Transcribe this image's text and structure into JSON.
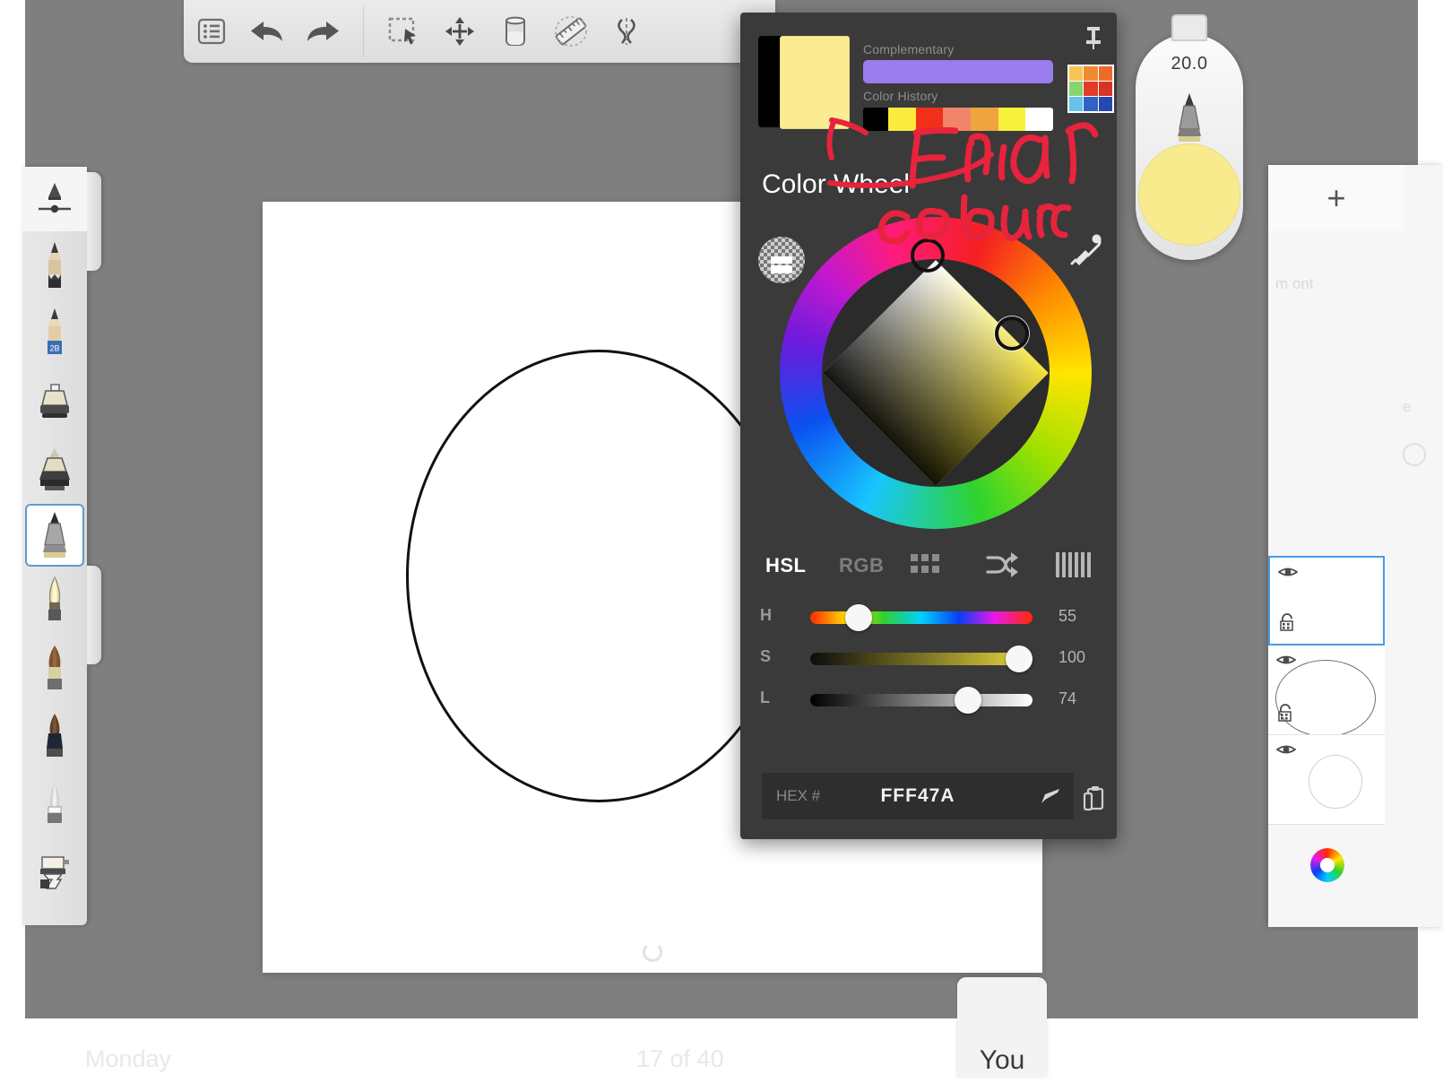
{
  "app": {
    "canvas_bg": "#807f7f",
    "paper_color": "#ffffff"
  },
  "toolbar": {
    "items": [
      {
        "name": "layers-menu-icon",
        "label": "Menu"
      },
      {
        "name": "undo-icon",
        "label": "Undo"
      },
      {
        "name": "redo-icon",
        "label": "Redo"
      },
      {
        "name": "selection-icon",
        "label": "Select"
      },
      {
        "name": "transform-move-icon",
        "label": "Transform"
      },
      {
        "name": "water-jar-icon",
        "label": "Water"
      },
      {
        "name": "ruler-icon",
        "label": "Ruler"
      },
      {
        "name": "symmetry-icon",
        "label": "Symmetry"
      }
    ]
  },
  "brush_rail": {
    "items": [
      {
        "name": "brush-size-slider-header",
        "label": "Brush Settings"
      },
      {
        "name": "brush-pencil",
        "label": "Pencil"
      },
      {
        "name": "brush-pencil-2b",
        "label": "2B Pencil",
        "badge": "2B"
      },
      {
        "name": "brush-eraser-block",
        "label": "Eraser"
      },
      {
        "name": "brush-marker",
        "label": "Marker"
      },
      {
        "name": "brush-inkpen",
        "label": "Ink Pen",
        "selected": true
      },
      {
        "name": "brush-calligraphy",
        "label": "Calligraphy"
      },
      {
        "name": "brush-round-brush",
        "label": "Round Brush"
      },
      {
        "name": "brush-flat-brush",
        "label": "Flat Brush"
      },
      {
        "name": "brush-airbrush",
        "label": "Airbrush"
      },
      {
        "name": "brush-paint-roller",
        "label": "Paint Roller"
      }
    ]
  },
  "size_pod": {
    "size_value": "20.0",
    "swatch_color": "#f7eb8e"
  },
  "right_panel": {
    "add_label": "+",
    "ghost_text": "m\nont",
    "ghost_e": "e",
    "layers": [
      {
        "name": "layer-3",
        "active": true,
        "has_lock": true,
        "thumb": "empty"
      },
      {
        "name": "layer-2",
        "active": false,
        "has_lock": true,
        "thumb": "big-circle"
      },
      {
        "name": "layer-1",
        "active": false,
        "has_lock": false,
        "thumb": "small-circle"
      }
    ],
    "color_wheel_button": "color-wheel-icon"
  },
  "color_dialog": {
    "title": "Color Wheel",
    "pin_icon": "pin-icon",
    "current_color": "#FBEC93",
    "previous_color": "#000000",
    "complementary_label": "Complementary",
    "complementary_color": "#9B7CED",
    "history_label": "Color History",
    "history_colors": [
      "#000000",
      "#FAEB3C",
      "#F03018",
      "#F0856A",
      "#EFA43E",
      "#F7F03A",
      "#FFFFFF"
    ],
    "palette_grid": [
      "#F6C556",
      "#F08A30",
      "#EE6A2B",
      "#86D46E",
      "#E13C28",
      "#D63427",
      "#64C3E8",
      "#3063C4",
      "#2449B2"
    ],
    "alpha_icon": "transparency-icon",
    "eyedropper_icon": "eyedropper-icon",
    "mode_tabs": [
      {
        "name": "tab-hsl",
        "label": "HSL",
        "active": true
      },
      {
        "name": "tab-rgb",
        "label": "RGB",
        "active": false
      }
    ],
    "mode_icons": [
      {
        "name": "swatch-grid-icon"
      },
      {
        "name": "shuffle-icon"
      },
      {
        "name": "gradient-bars-icon"
      }
    ],
    "sliders": [
      {
        "name": "hue-slider",
        "label": "H",
        "value": "55",
        "knob_pct": 18
      },
      {
        "name": "saturation-slider",
        "label": "S",
        "value": "100",
        "knob_pct": 100
      },
      {
        "name": "lightness-slider",
        "label": "L",
        "value": "74",
        "knob_pct": 74
      }
    ],
    "hex_label": "HEX #",
    "hex_value": "FFF47A",
    "hex_edit_icon": "pencil-edit-icon",
    "copy_icon": "copy-clipboard-icon"
  },
  "annotation": {
    "text_line1": "Final",
    "text_line2": "colour",
    "color": "#e8233c"
  },
  "bottom_bar": {
    "day_label": "Monday",
    "page_label": "17 of 40",
    "right_label": "",
    "you_label": "You"
  }
}
